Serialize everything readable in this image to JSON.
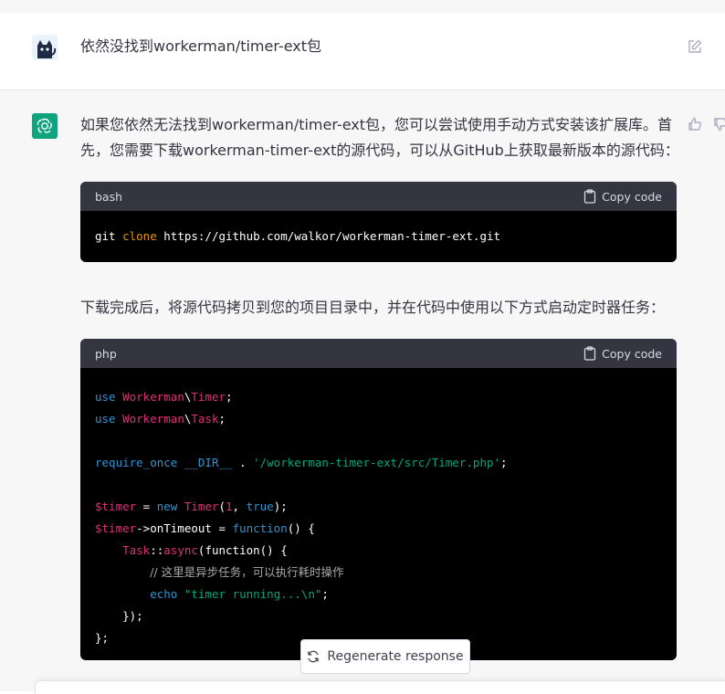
{
  "user_message": {
    "avatar_icon": "cat-avatar-icon",
    "text": "依然没找到workerman/timer-ext包",
    "edit_icon": "edit-icon"
  },
  "assistant_message": {
    "avatar_icon": "openai-logo-icon",
    "avatar_color": "#10a37f",
    "paragraph1": "如果您依然无法找到workerman/timer-ext包，您可以尝试使用手动方式安装该扩展库。首先，您需要下载workerman-timer-ext的源代码，可以从GitHub上获取最新版本的源代码：",
    "paragraph2": "下载完成后，将源代码拷贝到您的项目目录中，并在代码中使用以下方式启动定时器任务：",
    "feedback_icons": [
      "thumbs-up-icon",
      "thumbs-down-icon"
    ]
  },
  "code_blocks": [
    {
      "language": "bash",
      "copy_label": "Copy code",
      "line1": {
        "cmd": "git ",
        "verb": "clone",
        "rest": " https://github.com/walkor/workerman-timer-ext.git"
      }
    },
    {
      "language": "php",
      "copy_label": "Copy code",
      "lines": {
        "l1_kw": "use",
        "l1_ns": "Workerman",
        "l1_sep": "\\",
        "l1_cls": "Timer",
        "l1_end": ";",
        "l2_kw": "use",
        "l2_ns": "Workerman",
        "l2_sep": "\\",
        "l2_cls": "Task",
        "l2_end": ";",
        "l4_kw": "require_once",
        "l4_const": "__DIR__",
        "l4_dot": " . ",
        "l4_str": "'/workerman-timer-ext/src/Timer.php'",
        "l4_end": ";",
        "l6_var": "$timer",
        "l6_eq": " = ",
        "l6_new": "new",
        "l6_cls": "Timer",
        "l6_open": "(",
        "l6_num": "1",
        "l6_comma": ", ",
        "l6_bool": "true",
        "l6_end": ");",
        "l7_var": "$timer",
        "l7_arrow": "->onTimeout = ",
        "l7_fn": "function",
        "l7_end": "() {",
        "l8_cls": "Task",
        "l8_sep": "::",
        "l8_method": "async",
        "l8_end": "(function() {",
        "l9_cmt": "// 这里是异步任务，可以执行耗时操作",
        "l10_kw": "echo",
        "l10_str": "\"timer running...\\n\"",
        "l10_end": ";",
        "l11": "});",
        "l12": "};"
      }
    }
  ],
  "regenerate": {
    "label": "Regenerate response",
    "icon": "refresh-icon"
  }
}
